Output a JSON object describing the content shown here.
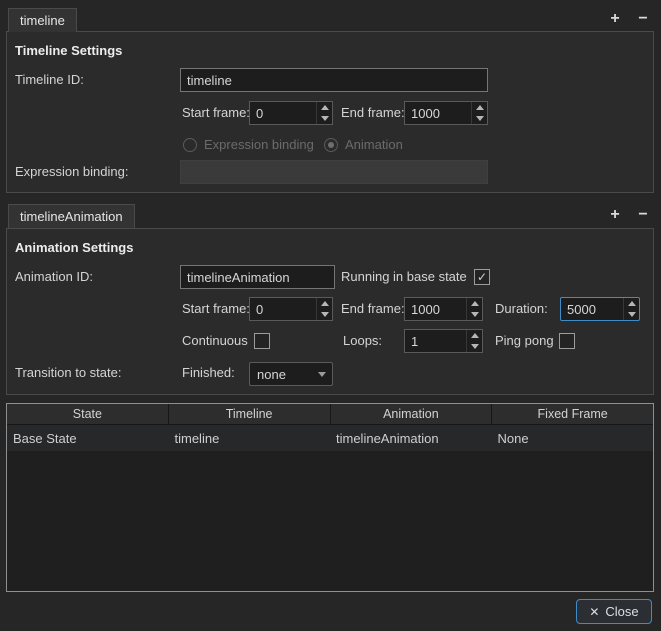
{
  "colors": {
    "background": "#262626",
    "accent": "#3f8cc9"
  },
  "icons": {
    "add": "+",
    "remove": "−",
    "check": "✓",
    "close": "✕"
  },
  "timeline_panel": {
    "tab_label": "timeline",
    "heading": "Timeline Settings",
    "timeline_id_label": "Timeline ID:",
    "timeline_id_value": "timeline",
    "start_frame_label": "Start frame:",
    "start_frame_value": "0",
    "end_frame_label": "End frame:",
    "end_frame_value": "1000",
    "expression_binding_radio": "Expression binding",
    "expression_binding_radio_selected": false,
    "animation_radio": "Animation",
    "animation_radio_selected": true,
    "expression_binding_label": "Expression binding:",
    "expression_binding_value": ""
  },
  "animation_panel": {
    "tab_label": "timelineAnimation",
    "heading": "Animation Settings",
    "animation_id_label": "Animation ID:",
    "animation_id_value": "timelineAnimation",
    "running_in_base_state_label": "Running in base state",
    "running_in_base_state_checked": true,
    "start_frame_label": "Start frame:",
    "start_frame_value": "0",
    "end_frame_label": "End frame:",
    "end_frame_value": "1000",
    "duration_label": "Duration:",
    "duration_value": "5000",
    "continuous_label": "Continuous",
    "continuous_checked": false,
    "loops_label": "Loops:",
    "loops_value": "1",
    "ping_pong_label": "Ping pong",
    "ping_pong_checked": false,
    "transition_to_state_label": "Transition to state:",
    "finished_label": "Finished:",
    "finished_value": "none"
  },
  "states_table": {
    "columns": [
      "State",
      "Timeline",
      "Animation",
      "Fixed Frame"
    ],
    "rows": [
      [
        "Base State",
        "timeline",
        "timelineAnimation",
        "None"
      ]
    ]
  },
  "footer": {
    "close_label": "Close"
  }
}
